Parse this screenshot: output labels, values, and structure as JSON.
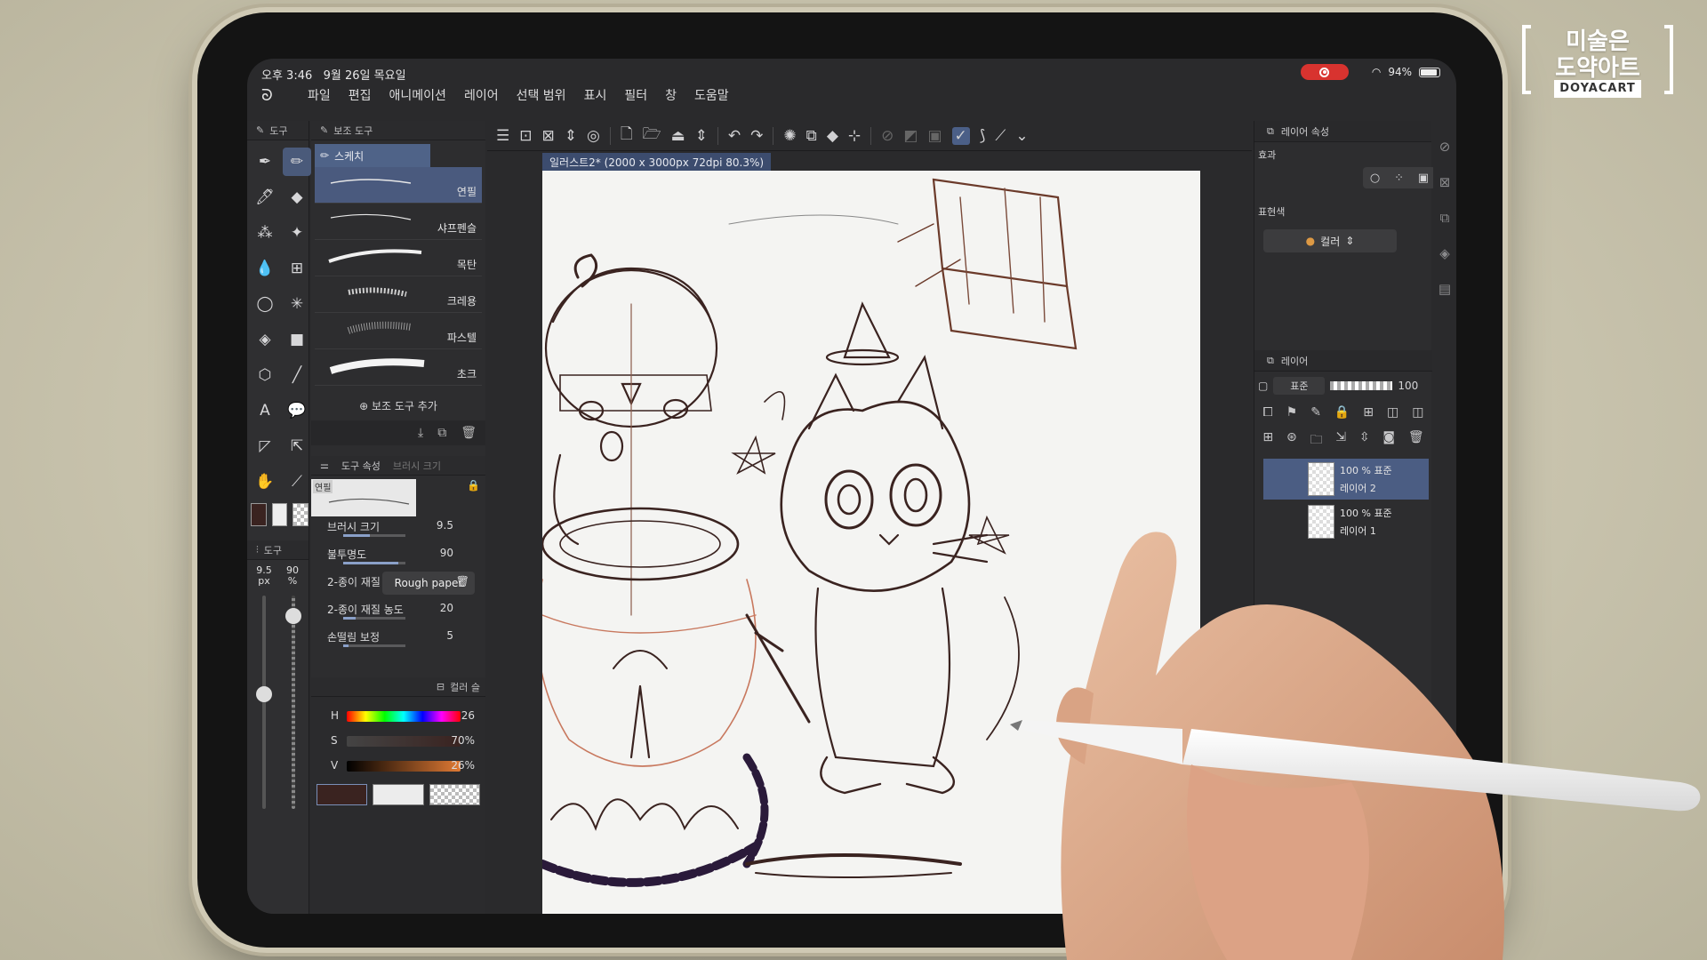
{
  "status": {
    "time": "오후 3:46",
    "date": "9월 26일 목요일",
    "battery": "94%"
  },
  "menu": [
    "파일",
    "편집",
    "애니메이션",
    "레이어",
    "선택 범위",
    "표시",
    "필터",
    "창",
    "도움말"
  ],
  "tool_panel": {
    "title": "도구",
    "sub_title": "도구"
  },
  "subtool_panel": {
    "title": "보조 도구",
    "group": "스케치",
    "brushes": [
      "연필",
      "샤프펜슬",
      "목탄",
      "크레용",
      "파스텔",
      "초크"
    ],
    "add_label": "보조 도구 추가"
  },
  "tool_props": {
    "title": "도구 속성",
    "tab2": "브러시 크기",
    "preview_label": "연필",
    "brush_size_label": "브러시 크기",
    "brush_size_value": "9.5",
    "opacity_label": "불투명도",
    "opacity_value": "90",
    "paper_label": "2-종이 재질",
    "paper_value": "Rough paper",
    "paper_density_label": "2-종이 재질 농도",
    "paper_density_value": "20",
    "stabilize_label": "손떨림 보정",
    "stabilize_value": "5"
  },
  "size_indicator": {
    "size": "9.5",
    "size_unit": "px",
    "opacity": "90",
    "opacity_unit": "%"
  },
  "color_panel": {
    "title": "컬러 슬",
    "h_label": "H",
    "h_value": "26",
    "s_label": "S",
    "s_value": "70%",
    "v_label": "V",
    "v_value": "26%",
    "main_color": "#3a2320"
  },
  "document_tab": "일러스트2* (2000 x 3000px 72dpi 80.3%)",
  "layer_props": {
    "title": "레이어 속성",
    "effect_label": "효과",
    "expr_label": "표현색",
    "expr_value": "컬러"
  },
  "layers": {
    "title": "레이어",
    "blend": "표준",
    "opacity": "100",
    "items": [
      {
        "l1": "100 % 표준",
        "l2": "레이어 2"
      },
      {
        "l1": "100 % 표준",
        "l2": "레이어 1"
      }
    ]
  },
  "watermark": {
    "line1": "미술은",
    "line2": "도약아트",
    "sub": "DOYACART"
  }
}
